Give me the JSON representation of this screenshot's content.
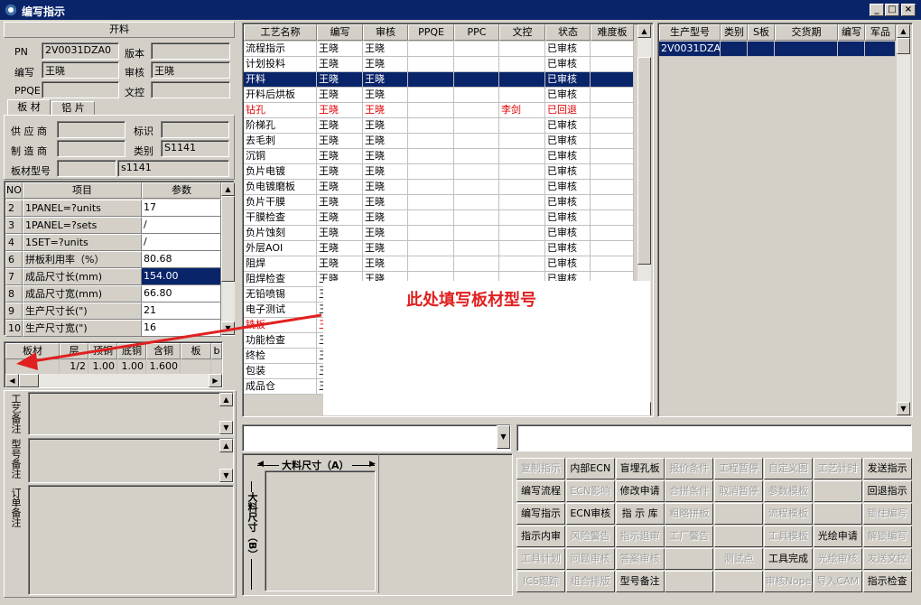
{
  "window": {
    "title": "编写指示",
    "min": "_",
    "max": "□",
    "close": "×"
  },
  "left": {
    "section_title": "开料",
    "pn_label": "PN",
    "pn_value": "2V0031DZA0",
    "version_label": "版本",
    "version_value": "",
    "author_label": "编写",
    "author_value": "王晓",
    "review_label": "审核",
    "review_value": "王晓",
    "ppqe_label": "PPQE",
    "ppqe_value": "",
    "doc_label": "文控",
    "doc_value": "",
    "tabs": [
      "板 材",
      "铝 片"
    ],
    "supplier_label": "供 应 商",
    "supplier_value": "",
    "mark_label": "标识",
    "mark_value": "",
    "maker_label": "制 造 商",
    "maker_value": "",
    "category_label": "类别",
    "category_value": "S1141",
    "model_label": "板材型号",
    "model_code": "",
    "model_value": "s1141",
    "param_headers": [
      "NO",
      "项目",
      "参数"
    ],
    "params": [
      {
        "no": "2",
        "item": "1PANEL=?units",
        "value": "17"
      },
      {
        "no": "3",
        "item": "1PANEL=?sets",
        "value": "/"
      },
      {
        "no": "4",
        "item": "1SET=?units",
        "value": "/"
      },
      {
        "no": "6",
        "item": "拼板利用率（%）",
        "value": "80.68"
      },
      {
        "no": "7",
        "item": "成品尺寸长(mm)",
        "value": "154.00"
      },
      {
        "no": "8",
        "item": "成品尺寸宽(mm)",
        "value": "66.80"
      },
      {
        "no": "9",
        "item": "生产尺寸长(\")",
        "value": "21"
      },
      {
        "no": "10",
        "item": "生产尺寸宽(\")",
        "value": "16"
      }
    ],
    "mat_headers": [
      "板材",
      "层",
      "顶铜",
      "底铜",
      "含铜mm",
      "板mm",
      "b"
    ],
    "mat_row": [
      "",
      "1/2",
      "1.00",
      "1.00",
      "1.600",
      "",
      ""
    ],
    "notes": [
      "工艺备注",
      "型号备注",
      "订单备注"
    ]
  },
  "process": {
    "headers": [
      "工艺名称",
      "编写",
      "审核",
      "PPQE",
      "PPC",
      "文控",
      "状态",
      "难度板"
    ],
    "rows": [
      [
        "流程指示",
        "王晓",
        "王晓",
        "",
        "",
        "",
        "已审核",
        ""
      ],
      [
        "计划投料",
        "王晓",
        "王晓",
        "",
        "",
        "",
        "已审核",
        ""
      ],
      [
        "开料",
        "王晓",
        "王晓",
        "",
        "",
        "",
        "已审核",
        ""
      ],
      [
        "开料后烘板",
        "王晓",
        "王晓",
        "",
        "",
        "",
        "已审核",
        ""
      ],
      [
        "钻孔",
        "王晓",
        "王晓",
        "",
        "",
        "李剑",
        "已回退",
        ""
      ],
      [
        "阶梯孔",
        "王晓",
        "王晓",
        "",
        "",
        "",
        "已审核",
        ""
      ],
      [
        "去毛刺",
        "王晓",
        "王晓",
        "",
        "",
        "",
        "已审核",
        ""
      ],
      [
        "沉铜",
        "王晓",
        "王晓",
        "",
        "",
        "",
        "已审核",
        ""
      ],
      [
        "负片电镀",
        "王晓",
        "王晓",
        "",
        "",
        "",
        "已审核",
        ""
      ],
      [
        "负电镀磨板",
        "王晓",
        "王晓",
        "",
        "",
        "",
        "已审核",
        ""
      ],
      [
        "负片干膜",
        "王晓",
        "王晓",
        "",
        "",
        "",
        "已审核",
        ""
      ],
      [
        "干膜检查",
        "王晓",
        "王晓",
        "",
        "",
        "",
        "已审核",
        ""
      ],
      [
        "负片蚀刻",
        "王晓",
        "王晓",
        "",
        "",
        "",
        "已审核",
        ""
      ],
      [
        "外层AOI",
        "王晓",
        "王晓",
        "",
        "",
        "",
        "已审核",
        ""
      ],
      [
        "阻焊",
        "王晓",
        "王晓",
        "",
        "",
        "",
        "已审核",
        ""
      ],
      [
        "阻焊检查",
        "王晓",
        "王晓",
        "",
        "",
        "",
        "已审核",
        ""
      ],
      [
        "无铅喷锡",
        "王",
        "",
        "",
        "",
        "",
        "",
        ""
      ],
      [
        "电子测试",
        "王",
        "",
        "",
        "",
        "",
        "",
        ""
      ],
      [
        "铣板",
        "王",
        "",
        "",
        "",
        "",
        "",
        ""
      ],
      [
        "功能检查",
        "王",
        "",
        "",
        "",
        "",
        "",
        ""
      ],
      [
        "终检",
        "王",
        "",
        "",
        "",
        "",
        "",
        ""
      ],
      [
        "包装",
        "王",
        "",
        "",
        "",
        "",
        "",
        ""
      ],
      [
        "成品仓",
        "王",
        "",
        "",
        "",
        "",
        "",
        ""
      ]
    ]
  },
  "annotation": "此处填写板材型号",
  "right_list": {
    "headers": [
      "生产型号",
      "类别",
      "S板",
      "交货期",
      "编写",
      "军品"
    ],
    "rows": [
      [
        "2V0031DZA0",
        "",
        "",
        "",
        "",
        ""
      ]
    ]
  },
  "dims": {
    "a_label": "大料尺寸（A）",
    "b_label": "大料尺寸（B）"
  },
  "buttons": [
    [
      "复制指示",
      "内部ECN",
      "盲埋孔板",
      "报价条件",
      "工程暂停",
      "自定义图",
      "工艺计时",
      "发送指示"
    ],
    [
      "编写流程",
      "ECN影响",
      "修改申请",
      "合拼条件",
      "取消暂停",
      "参数模板",
      "",
      "回退指示"
    ],
    [
      "编写指示",
      "ECN审核",
      "指 示 库",
      "粗略拼板",
      "",
      "流程模板",
      "",
      "锁住编写"
    ],
    [
      "指示内审",
      "风险警告",
      "指示退审",
      "工厂警告",
      "",
      "工具模板",
      "光绘申请",
      "解锁编写"
    ],
    [
      "工具计划",
      "问题审核",
      "答案审核",
      "",
      "测试点",
      "工具完成",
      "光绘审核",
      "发送文控"
    ],
    [
      "ICS跟踪",
      "组合排版",
      "型号备注",
      "",
      "",
      "审核Nope",
      "导入CAM",
      "指示检查"
    ]
  ],
  "buttons_disabled": [
    [
      true,
      false,
      false,
      true,
      true,
      true,
      true,
      false
    ],
    [
      false,
      true,
      false,
      true,
      true,
      true,
      true,
      false
    ],
    [
      false,
      false,
      false,
      true,
      true,
      true,
      true,
      true
    ],
    [
      false,
      true,
      true,
      true,
      true,
      true,
      false,
      true
    ],
    [
      true,
      true,
      true,
      true,
      true,
      false,
      true,
      true
    ],
    [
      true,
      true,
      false,
      true,
      true,
      true,
      true,
      false
    ]
  ],
  "colors": {
    "selection": "#0a246a",
    "reject": "#e00000",
    "annotation": "#e02020"
  }
}
